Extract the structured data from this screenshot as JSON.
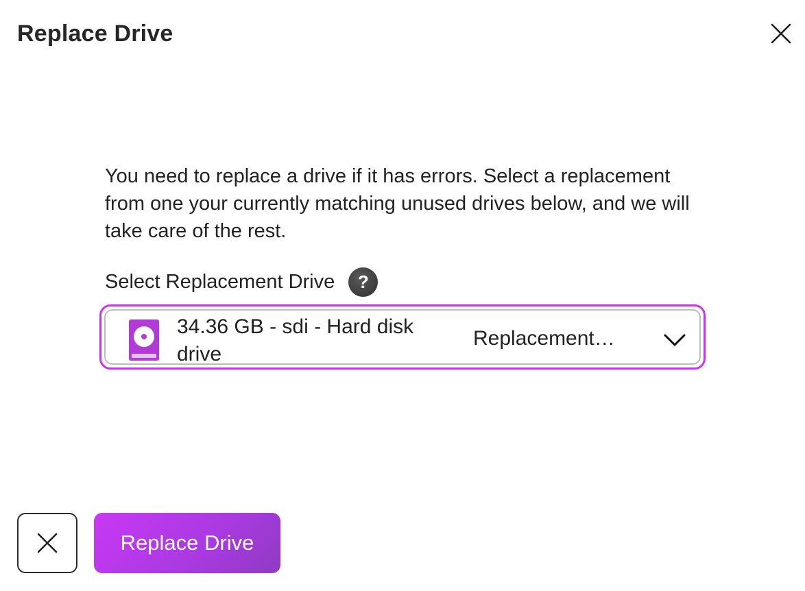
{
  "dialog": {
    "title": "Replace Drive",
    "close_icon": "close-icon"
  },
  "description": "You need to replace a drive if it has errors. Select a replacement from one your currently matching unused drives below, and we will take care of the rest.",
  "field": {
    "label": "Select Replacement Drive",
    "help_icon": "question-mark-icon",
    "help_glyph": "?"
  },
  "select": {
    "selected_option": "34.36 GB - sdi - Hard disk drive",
    "status": "Replacement…",
    "icon": "hard-disk-drive-icon",
    "chevron_icon": "chevron-down-icon"
  },
  "actions": {
    "cancel_icon": "close-icon",
    "primary_label": "Replace Drive"
  },
  "colors": {
    "accent": "#cc33f0",
    "drive_icon": "#b23ad6",
    "primary_gradient_start": "#c938f5",
    "primary_gradient_end": "#8e3bc2",
    "help_icon_bg": "#3a3a3a"
  }
}
